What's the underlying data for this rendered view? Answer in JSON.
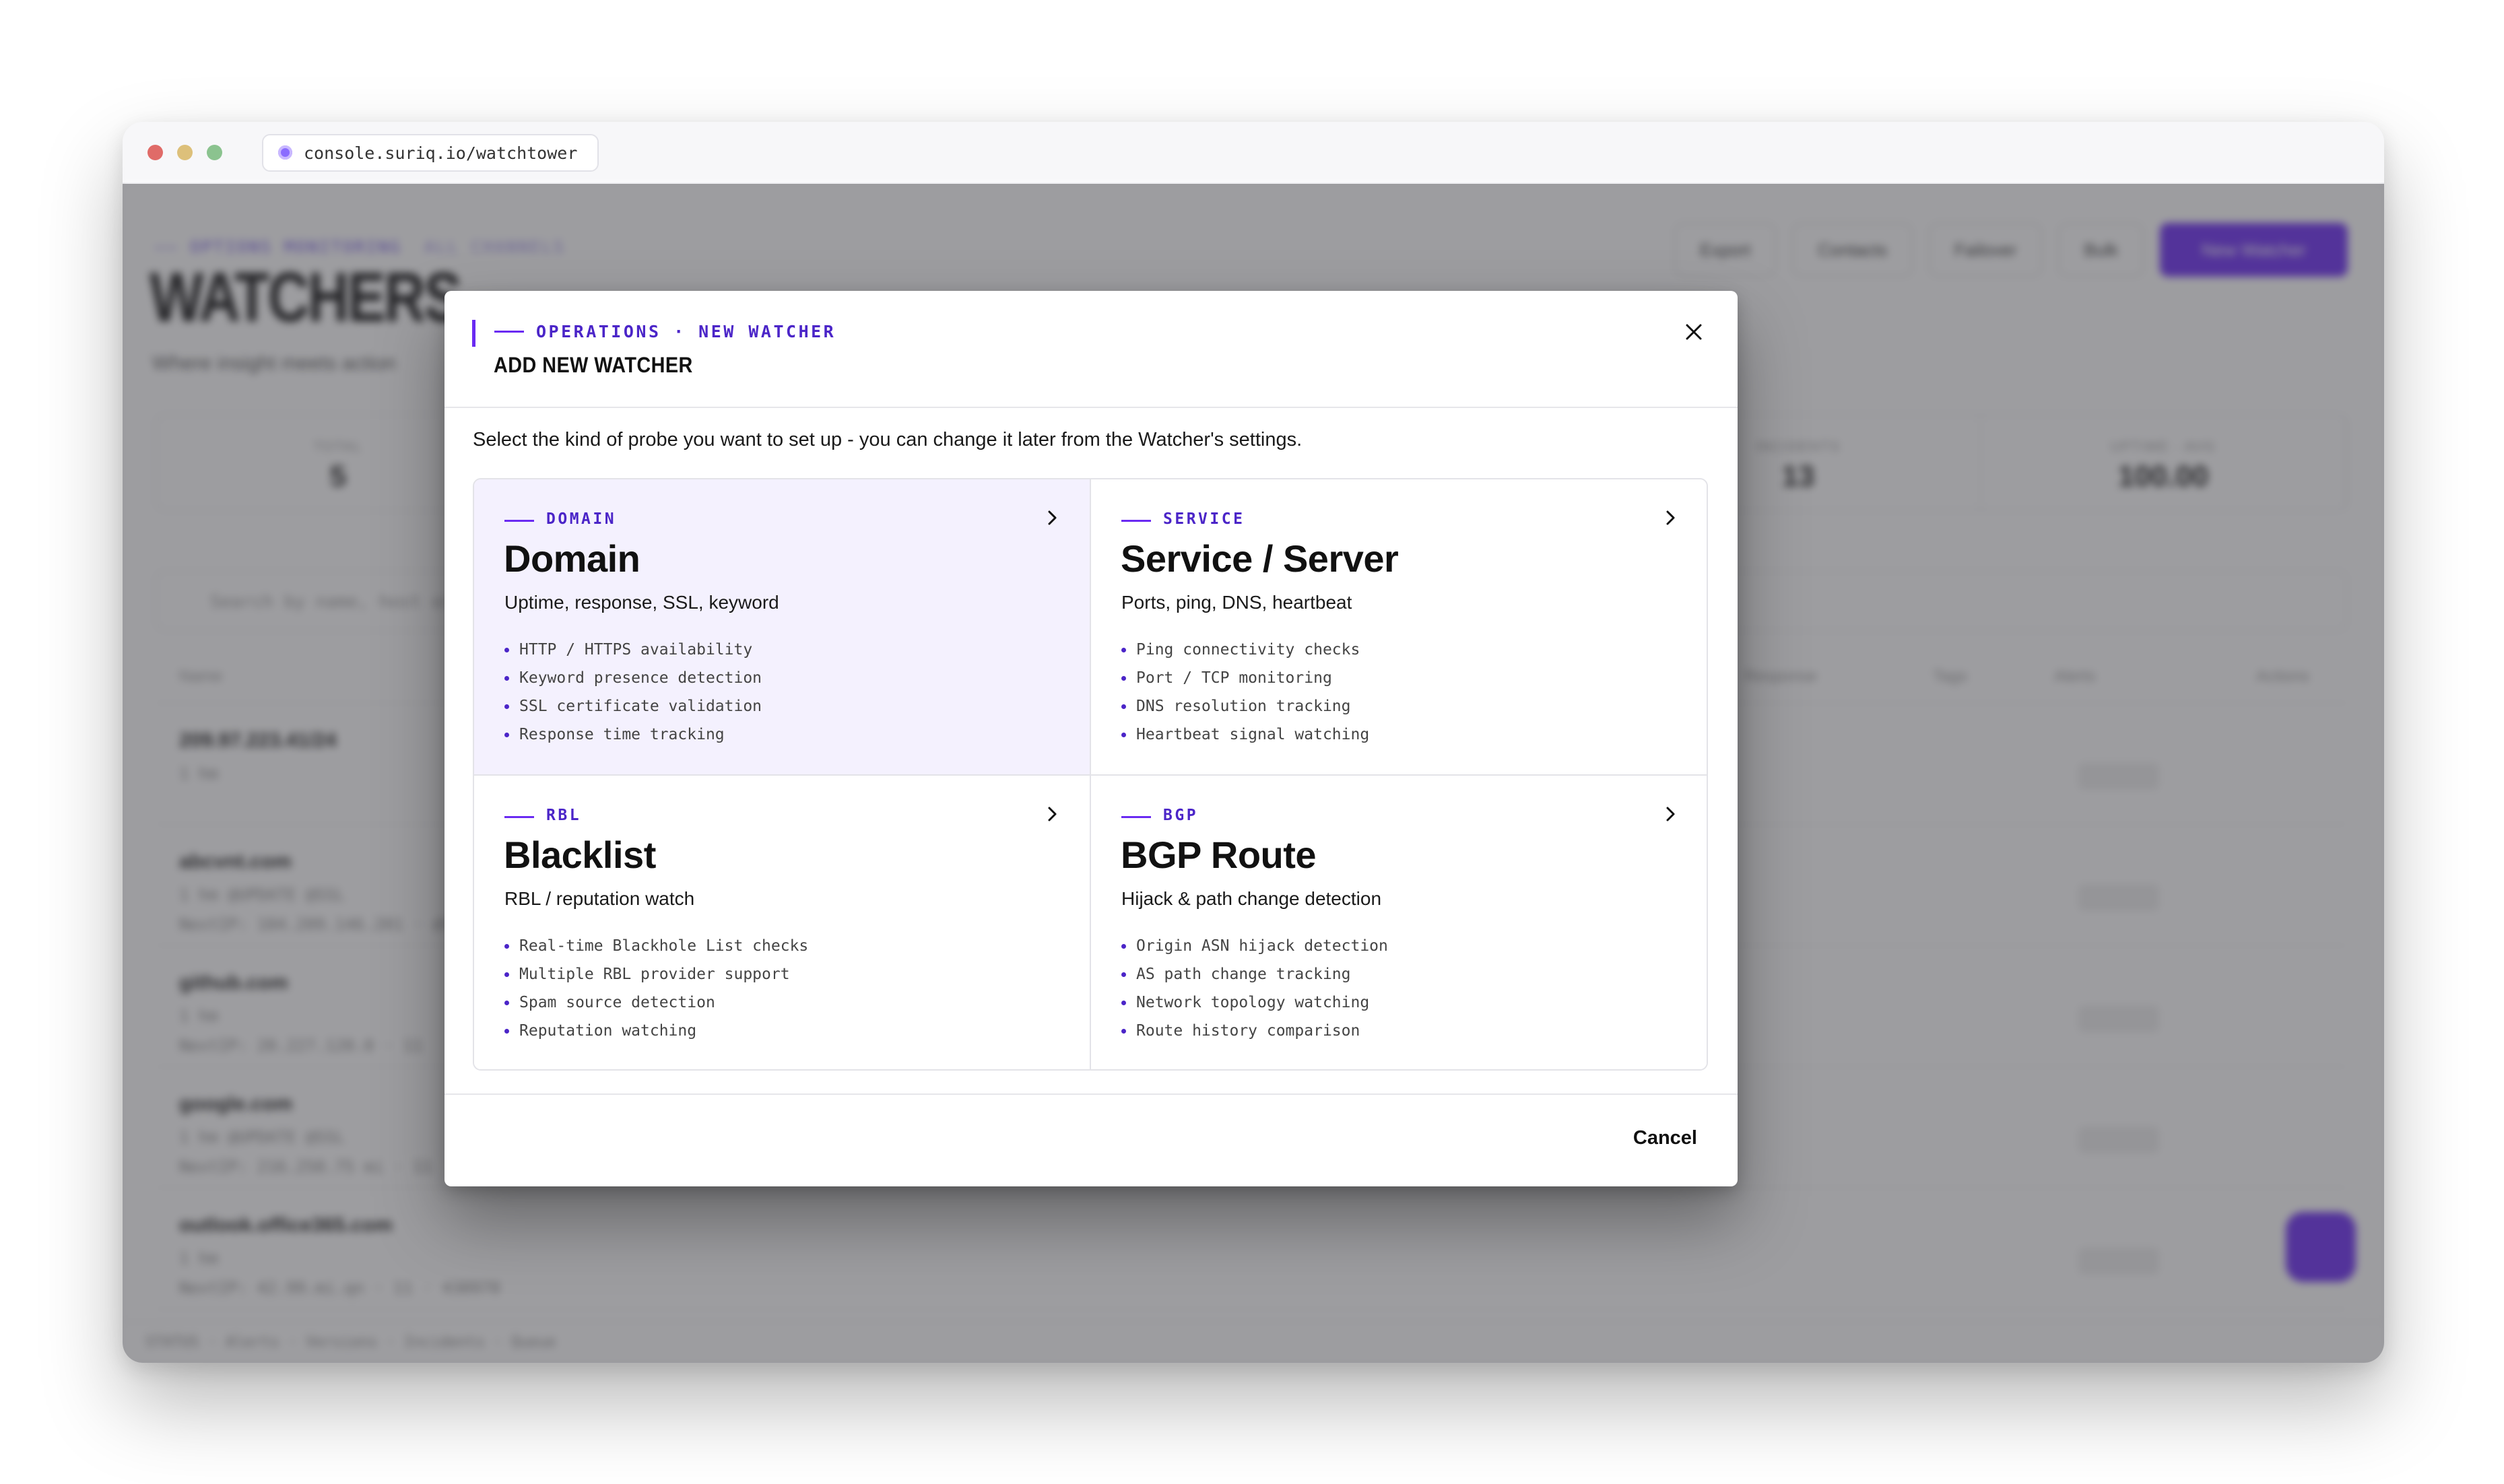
{
  "browser": {
    "url": "console.suriq.io/watchtower"
  },
  "background": {
    "eyebrow": "—— OPTIONS MONITORING",
    "eyebrow_sub": "ALL CHANNELS",
    "title": "WATCHERS",
    "subtitle": "Where insight meets action",
    "toolbar": [
      "Export",
      "Contacts",
      "Failover",
      "Bulk",
      "New Watcher"
    ],
    "stats": [
      {
        "label": "TOTAL",
        "value": "5"
      },
      {
        "label": "",
        "value": ""
      },
      {
        "label": "",
        "value": ""
      },
      {
        "label": "",
        "value": ""
      },
      {
        "label": "INCIDENTS",
        "value": "13"
      },
      {
        "label": "UPTIME · AVG",
        "value": "100.00"
      }
    ],
    "search_placeholder": "Search by name, host or…",
    "columns": [
      "Name",
      "Response",
      "Tags",
      "Alerts",
      "Actions"
    ],
    "rows": [
      {
        "host": "209.97.223.41/24",
        "meta": "1 hm",
        "meta2": ""
      },
      {
        "host": "abcvnt.com",
        "meta": "1 hm  @UPDATE  @SSL",
        "meta2": "NextIP: 104.209.146.201 · dt"
      },
      {
        "host": "github.com",
        "meta": "1 hm",
        "meta2": "NextIP: 20.227.120.0 · 11"
      },
      {
        "host": "google.com",
        "meta": "1 hm  @UPDATE  @SSL",
        "meta2": "NextIP: 216.250.75 mi · 11"
      },
      {
        "host": "outlook.office365.com",
        "meta": "1 hm",
        "meta2": "NextIP: 42.99.mi.qn · 11 · 430970"
      }
    ],
    "footer": "STATUS  ·  Alerts  ·  Versions  ·  Incidents  ·  Queue"
  },
  "modal": {
    "eyebrow": "OPERATIONS · NEW WATCHER",
    "title": "ADD NEW WATCHER",
    "intro": "Select the kind of probe you want to set up - you can change it later from the Watcher's settings.",
    "cards": [
      {
        "tag": "DOMAIN",
        "title": "Domain",
        "subtitle": "Uptime, response, SSL, keyword",
        "features": [
          "HTTP / HTTPS availability",
          "Keyword presence detection",
          "SSL certificate validation",
          "Response time tracking"
        ]
      },
      {
        "tag": "SERVICE",
        "title": "Service / Server",
        "subtitle": "Ports, ping, DNS, heartbeat",
        "features": [
          "Ping connectivity checks",
          "Port / TCP monitoring",
          "DNS resolution tracking",
          "Heartbeat signal watching"
        ]
      },
      {
        "tag": "RBL",
        "title": "Blacklist",
        "subtitle": "RBL / reputation watch",
        "features": [
          "Real-time Blackhole List checks",
          "Multiple RBL provider support",
          "Spam source detection",
          "Reputation watching"
        ]
      },
      {
        "tag": "BGP",
        "title": "BGP Route",
        "subtitle": "Hijack & path change detection",
        "features": [
          "Origin ASN hijack detection",
          "AS path change tracking",
          "Network topology watching",
          "Route history comparison"
        ]
      }
    ],
    "cancel_label": "Cancel"
  },
  "colors": {
    "accent": "#6a2af2",
    "accent_text": "#4b25c8",
    "selected_card_bg": "#f4f1fe"
  },
  "icons": {
    "close": "close-icon",
    "chevron": "chevron-right-icon",
    "site": "site-favicon-icon"
  }
}
